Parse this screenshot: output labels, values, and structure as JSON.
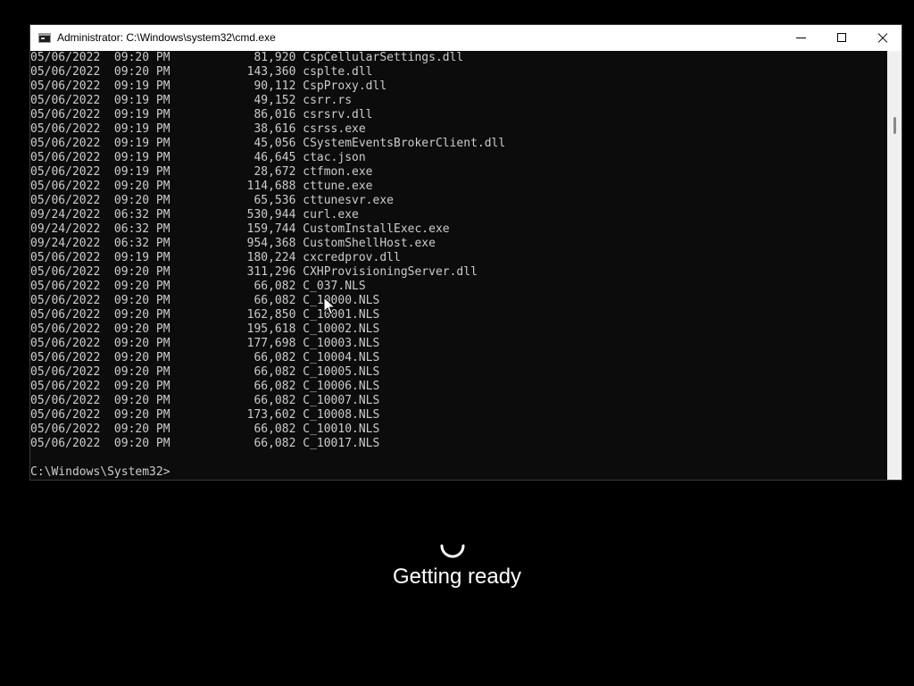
{
  "window": {
    "title": "Administrator: C:\\Windows\\system32\\cmd.exe",
    "icon": "cmd-icon",
    "controls": [
      "minimize-icon",
      "maximize-icon",
      "close-icon"
    ]
  },
  "console": {
    "lines": [
      "05/06/2022  09:20 PM            81,920 CspCellularSettings.dll",
      "05/06/2022  09:20 PM           143,360 csplte.dll",
      "05/06/2022  09:19 PM            90,112 CspProxy.dll",
      "05/06/2022  09:19 PM            49,152 csrr.rs",
      "05/06/2022  09:19 PM            86,016 csrsrv.dll",
      "05/06/2022  09:19 PM            38,616 csrss.exe",
      "05/06/2022  09:19 PM            45,056 CSystemEventsBrokerClient.dll",
      "05/06/2022  09:19 PM            46,645 ctac.json",
      "05/06/2022  09:19 PM            28,672 ctfmon.exe",
      "05/06/2022  09:20 PM           114,688 cttune.exe",
      "05/06/2022  09:20 PM            65,536 cttunesvr.exe",
      "09/24/2022  06:32 PM           530,944 curl.exe",
      "09/24/2022  06:32 PM           159,744 CustomInstallExec.exe",
      "09/24/2022  06:32 PM           954,368 CustomShellHost.exe",
      "05/06/2022  09:19 PM           180,224 cxcredprov.dll",
      "05/06/2022  09:20 PM           311,296 CXHProvisioningServer.dll",
      "05/06/2022  09:20 PM            66,082 C_037.NLS",
      "05/06/2022  09:20 PM            66,082 C_10000.NLS",
      "05/06/2022  09:20 PM           162,850 C_10001.NLS",
      "05/06/2022  09:20 PM           195,618 C_10002.NLS",
      "05/06/2022  09:20 PM           177,698 C_10003.NLS",
      "05/06/2022  09:20 PM            66,082 C_10004.NLS",
      "05/06/2022  09:20 PM            66,082 C_10005.NLS",
      "05/06/2022  09:20 PM            66,082 C_10006.NLS",
      "05/06/2022  09:20 PM            66,082 C_10007.NLS",
      "05/06/2022  09:20 PM           173,602 C_10008.NLS",
      "05/06/2022  09:20 PM            66,082 C_10010.NLS",
      "05/06/2022  09:20 PM            66,082 C_10017.NLS"
    ],
    "prompt": "C:\\Windows\\System32>"
  },
  "status": {
    "message": "Getting ready",
    "icon": "spinner-icon"
  },
  "colors": {
    "console_bg": "#0c0c0c",
    "console_text": "#cccccc",
    "desktop_bg": "#000000",
    "title_bar": "#ffffff"
  }
}
